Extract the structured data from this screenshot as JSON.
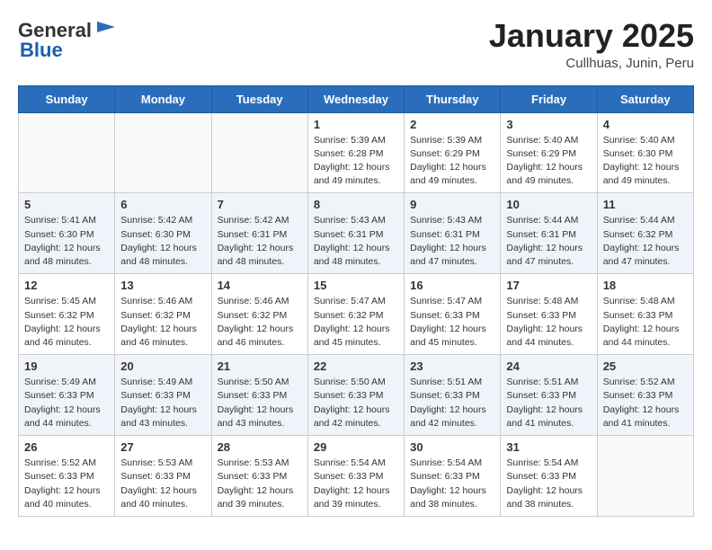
{
  "header": {
    "logo_general": "General",
    "logo_blue": "Blue",
    "month_title": "January 2025",
    "location": "Cullhuas, Junin, Peru"
  },
  "weekdays": [
    "Sunday",
    "Monday",
    "Tuesday",
    "Wednesday",
    "Thursday",
    "Friday",
    "Saturday"
  ],
  "weeks": [
    [
      {
        "day": "",
        "info": ""
      },
      {
        "day": "",
        "info": ""
      },
      {
        "day": "",
        "info": ""
      },
      {
        "day": "1",
        "info": "Sunrise: 5:39 AM\nSunset: 6:28 PM\nDaylight: 12 hours\nand 49 minutes."
      },
      {
        "day": "2",
        "info": "Sunrise: 5:39 AM\nSunset: 6:29 PM\nDaylight: 12 hours\nand 49 minutes."
      },
      {
        "day": "3",
        "info": "Sunrise: 5:40 AM\nSunset: 6:29 PM\nDaylight: 12 hours\nand 49 minutes."
      },
      {
        "day": "4",
        "info": "Sunrise: 5:40 AM\nSunset: 6:30 PM\nDaylight: 12 hours\nand 49 minutes."
      }
    ],
    [
      {
        "day": "5",
        "info": "Sunrise: 5:41 AM\nSunset: 6:30 PM\nDaylight: 12 hours\nand 48 minutes."
      },
      {
        "day": "6",
        "info": "Sunrise: 5:42 AM\nSunset: 6:30 PM\nDaylight: 12 hours\nand 48 minutes."
      },
      {
        "day": "7",
        "info": "Sunrise: 5:42 AM\nSunset: 6:31 PM\nDaylight: 12 hours\nand 48 minutes."
      },
      {
        "day": "8",
        "info": "Sunrise: 5:43 AM\nSunset: 6:31 PM\nDaylight: 12 hours\nand 48 minutes."
      },
      {
        "day": "9",
        "info": "Sunrise: 5:43 AM\nSunset: 6:31 PM\nDaylight: 12 hours\nand 47 minutes."
      },
      {
        "day": "10",
        "info": "Sunrise: 5:44 AM\nSunset: 6:31 PM\nDaylight: 12 hours\nand 47 minutes."
      },
      {
        "day": "11",
        "info": "Sunrise: 5:44 AM\nSunset: 6:32 PM\nDaylight: 12 hours\nand 47 minutes."
      }
    ],
    [
      {
        "day": "12",
        "info": "Sunrise: 5:45 AM\nSunset: 6:32 PM\nDaylight: 12 hours\nand 46 minutes."
      },
      {
        "day": "13",
        "info": "Sunrise: 5:46 AM\nSunset: 6:32 PM\nDaylight: 12 hours\nand 46 minutes."
      },
      {
        "day": "14",
        "info": "Sunrise: 5:46 AM\nSunset: 6:32 PM\nDaylight: 12 hours\nand 46 minutes."
      },
      {
        "day": "15",
        "info": "Sunrise: 5:47 AM\nSunset: 6:32 PM\nDaylight: 12 hours\nand 45 minutes."
      },
      {
        "day": "16",
        "info": "Sunrise: 5:47 AM\nSunset: 6:33 PM\nDaylight: 12 hours\nand 45 minutes."
      },
      {
        "day": "17",
        "info": "Sunrise: 5:48 AM\nSunset: 6:33 PM\nDaylight: 12 hours\nand 44 minutes."
      },
      {
        "day": "18",
        "info": "Sunrise: 5:48 AM\nSunset: 6:33 PM\nDaylight: 12 hours\nand 44 minutes."
      }
    ],
    [
      {
        "day": "19",
        "info": "Sunrise: 5:49 AM\nSunset: 6:33 PM\nDaylight: 12 hours\nand 44 minutes."
      },
      {
        "day": "20",
        "info": "Sunrise: 5:49 AM\nSunset: 6:33 PM\nDaylight: 12 hours\nand 43 minutes."
      },
      {
        "day": "21",
        "info": "Sunrise: 5:50 AM\nSunset: 6:33 PM\nDaylight: 12 hours\nand 43 minutes."
      },
      {
        "day": "22",
        "info": "Sunrise: 5:50 AM\nSunset: 6:33 PM\nDaylight: 12 hours\nand 42 minutes."
      },
      {
        "day": "23",
        "info": "Sunrise: 5:51 AM\nSunset: 6:33 PM\nDaylight: 12 hours\nand 42 minutes."
      },
      {
        "day": "24",
        "info": "Sunrise: 5:51 AM\nSunset: 6:33 PM\nDaylight: 12 hours\nand 41 minutes."
      },
      {
        "day": "25",
        "info": "Sunrise: 5:52 AM\nSunset: 6:33 PM\nDaylight: 12 hours\nand 41 minutes."
      }
    ],
    [
      {
        "day": "26",
        "info": "Sunrise: 5:52 AM\nSunset: 6:33 PM\nDaylight: 12 hours\nand 40 minutes."
      },
      {
        "day": "27",
        "info": "Sunrise: 5:53 AM\nSunset: 6:33 PM\nDaylight: 12 hours\nand 40 minutes."
      },
      {
        "day": "28",
        "info": "Sunrise: 5:53 AM\nSunset: 6:33 PM\nDaylight: 12 hours\nand 39 minutes."
      },
      {
        "day": "29",
        "info": "Sunrise: 5:54 AM\nSunset: 6:33 PM\nDaylight: 12 hours\nand 39 minutes."
      },
      {
        "day": "30",
        "info": "Sunrise: 5:54 AM\nSunset: 6:33 PM\nDaylight: 12 hours\nand 38 minutes."
      },
      {
        "day": "31",
        "info": "Sunrise: 5:54 AM\nSunset: 6:33 PM\nDaylight: 12 hours\nand 38 minutes."
      },
      {
        "day": "",
        "info": ""
      }
    ]
  ]
}
